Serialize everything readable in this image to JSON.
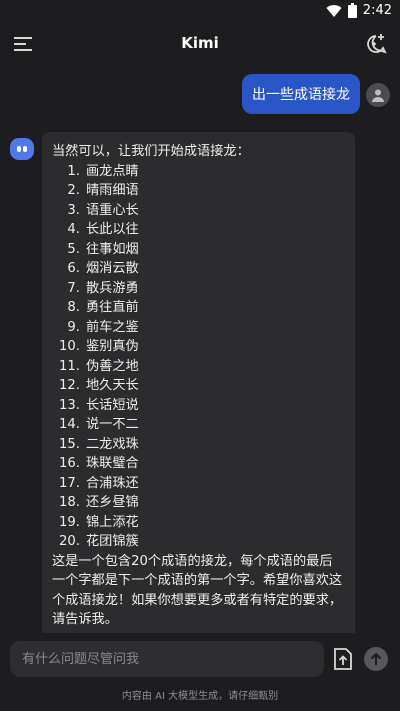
{
  "status_bar": {
    "time": "2:42",
    "icons": [
      "wifi-icon",
      "battery-icon"
    ]
  },
  "header": {
    "title": "Kimi",
    "icons": [
      "menu-icon",
      "new-chat-icon"
    ]
  },
  "conversation": {
    "user_message": "出一些成语接龙",
    "bot_intro": "当然可以，让我们开始成语接龙：",
    "idioms": [
      {
        "n": "1.",
        "t": "画龙点睛"
      },
      {
        "n": "2.",
        "t": "晴雨细语"
      },
      {
        "n": "3.",
        "t": "语重心长"
      },
      {
        "n": "4.",
        "t": "长此以往"
      },
      {
        "n": "5.",
        "t": "往事如烟"
      },
      {
        "n": "6.",
        "t": "烟消云散"
      },
      {
        "n": "7.",
        "t": "散兵游勇"
      },
      {
        "n": "8.",
        "t": "勇往直前"
      },
      {
        "n": "9.",
        "t": "前车之鉴"
      },
      {
        "n": "10.",
        "t": "鉴别真伪"
      },
      {
        "n": "11.",
        "t": "伪善之地"
      },
      {
        "n": "12.",
        "t": "地久天长"
      },
      {
        "n": "13.",
        "t": "长话短说"
      },
      {
        "n": "14.",
        "t": "说一不二"
      },
      {
        "n": "15.",
        "t": "二龙戏珠"
      },
      {
        "n": "16.",
        "t": "珠联璧合"
      },
      {
        "n": "17.",
        "t": "合浦珠还"
      },
      {
        "n": "18.",
        "t": "还乡昼锦"
      },
      {
        "n": "19.",
        "t": "锦上添花"
      },
      {
        "n": "20.",
        "t": "花团锦簇"
      }
    ],
    "bot_outro": "这是一个包含20个成语的接龙，每个成语的最后一个字都是下一个成语的第一个字。希望你喜欢这个成语接龙！如果你想要更多或者有特定的要求，请告诉我。"
  },
  "composer": {
    "placeholder": "有什么问题尽管问我",
    "disclaimer": "内容由 AI 大模型生成，请仔细甄别",
    "icons": [
      "upload-icon",
      "send-arrow-icon"
    ]
  },
  "colors": {
    "background": "#1d1d1f",
    "user_bubble": "#2a56c7",
    "bot_bubble": "#2c2c2e",
    "bot_avatar": "#4f79ea"
  }
}
